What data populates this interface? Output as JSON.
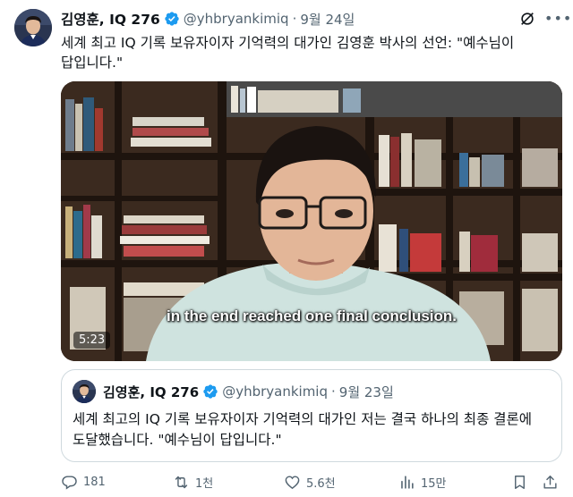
{
  "tweet": {
    "author_name": "김영훈, IQ 276",
    "handle": "@yhbryankimiq",
    "separator": "·",
    "date": "9월 24일",
    "text": "세계 최고 IQ 기록 보유자이자 기억력의 대가인 김영훈 박사의 선언: \"예수님이 답입니다.\""
  },
  "video": {
    "caption": "in the end reached one final conclusion.",
    "duration": "5:23"
  },
  "quoted_tweet": {
    "author_name": "김영훈, IQ 276",
    "handle": "@yhbryankimiq",
    "separator": "·",
    "date": "9월 23일",
    "text": "세계 최고의 IQ 기록 보유자이자 기억력의 대가인 저는 결국 하나의 최종 결론에 도달했습니다. \"예수님이 답입니다.\""
  },
  "actions": {
    "replies": "181",
    "retweets": "1천",
    "likes": "5.6천",
    "views": "15만"
  },
  "icons": [
    "verified-badge-icon",
    "grok-icon",
    "more-icon",
    "reply-icon",
    "retweet-icon",
    "like-icon",
    "views-icon",
    "bookmark-icon",
    "share-icon"
  ],
  "colors": {
    "text": "#0f1419",
    "secondary": "#536471",
    "verified": "#1d9bf0",
    "border": "#cfd9de"
  }
}
